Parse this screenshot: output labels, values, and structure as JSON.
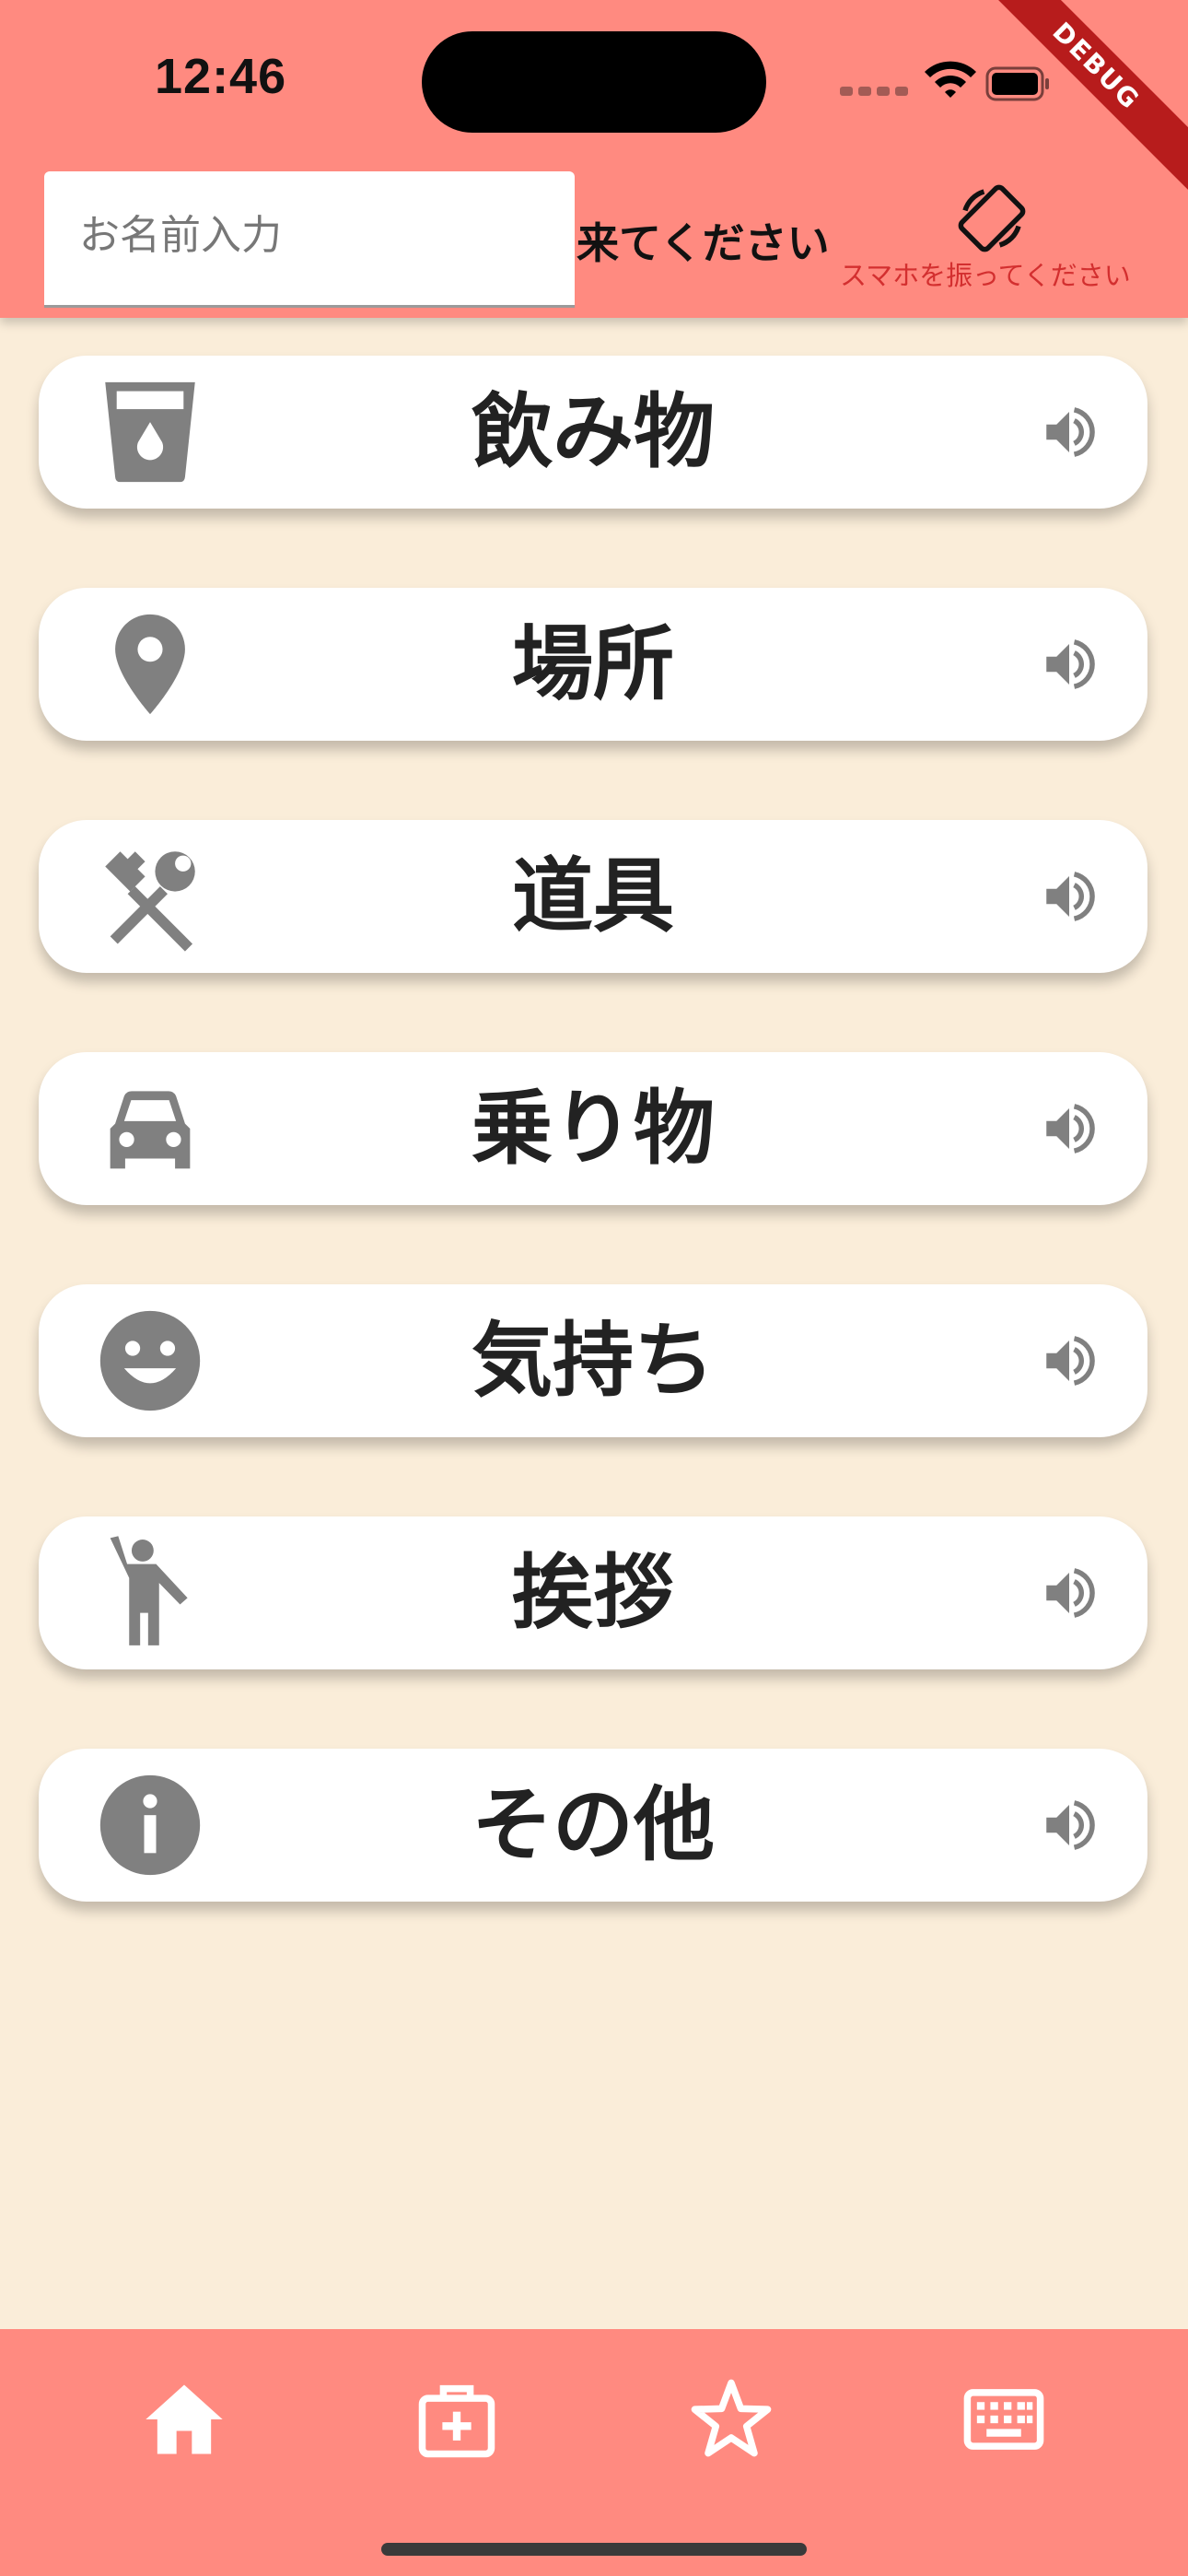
{
  "status_bar": {
    "time": "12:46"
  },
  "debug_banner": "DEBUG",
  "header": {
    "name_input_placeholder": "お名前入力",
    "call_text": "来てください",
    "shake_label": "スマホを振ってください"
  },
  "categories": [
    {
      "label": "飲み物",
      "icon": "drink-icon"
    },
    {
      "label": "場所",
      "icon": "location-pin-icon"
    },
    {
      "label": "道具",
      "icon": "tools-icon"
    },
    {
      "label": "乗り物",
      "icon": "car-icon"
    },
    {
      "label": "気持ち",
      "icon": "smile-icon"
    },
    {
      "label": "挨拶",
      "icon": "wave-person-icon"
    },
    {
      "label": "その他",
      "icon": "info-icon"
    }
  ],
  "bottom_nav": [
    "home-icon",
    "medical-kit-icon",
    "star-icon",
    "keyboard-icon"
  ],
  "colors": {
    "header": "#FF8A80",
    "background": "#FAEDD9",
    "icon_gray": "#808080",
    "shake_label": "#D32F2F"
  }
}
